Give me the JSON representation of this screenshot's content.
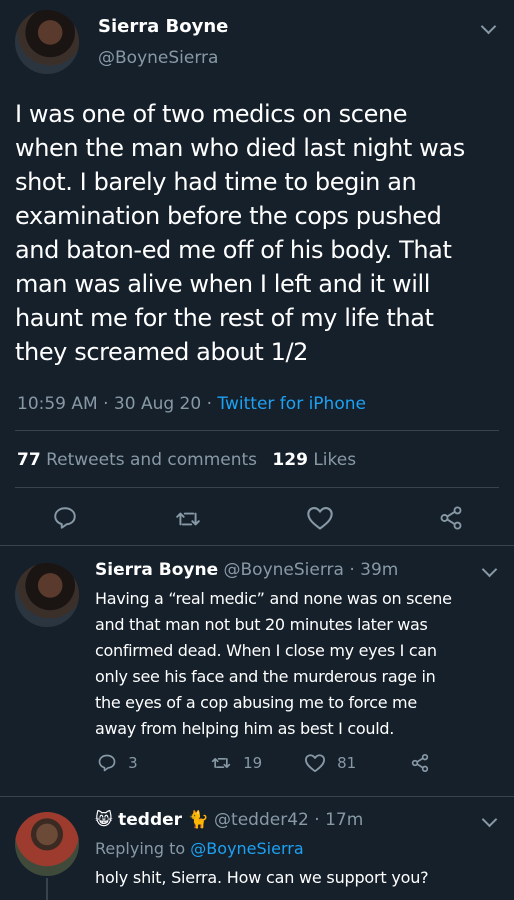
{
  "main_tweet": {
    "name": "Sierra Boyne",
    "handle": "@BoyneSierra",
    "lines": [
      "I was one of two medics on scene",
      "when the man who died last night was",
      "shot. I barely had time to begin an",
      "examination before the cops pushed",
      "and baton-ed me off of his body. That",
      "man was alive when I left and it will",
      "haunt me for the rest of my life that",
      "they screamed about 1/2"
    ],
    "time": "10:59 AM",
    "date": "30 Aug 20",
    "separator": "·",
    "source": "Twitter for iPhone",
    "retweet_count": "77",
    "retweet_label": "Retweets and comments",
    "like_count": "129",
    "like_label": "Likes"
  },
  "reply_1": {
    "name": "Sierra Boyne",
    "handle": "@BoyneSierra",
    "separator": "·",
    "age": "39m",
    "lines": [
      "Having a “real medic” and none was on scene",
      "and that man not but 20 minutes later was",
      "confirmed dead. When I close my eyes I can",
      "only see his face and the murderous rage in",
      "the eyes of a cop abusing me to force me",
      "away from helping him as best I could."
    ],
    "reply_count": "3",
    "retweet_count": "19",
    "like_count": "81"
  },
  "reply_2": {
    "emoji_left": "😸",
    "name": "tedder",
    "emoji_right": "🐈",
    "handle": "@tedder42",
    "separator": "·",
    "age": "17m",
    "replying_prefix": "Replying to",
    "replying_to": "@BoyneSierra",
    "text": "holy shit, Sierra. How can we support you?"
  },
  "colors": {
    "background": "#15202b",
    "text": "#ffffff",
    "secondary": "#8899a6",
    "accent": "#1da1f2",
    "divider": "#38444d"
  },
  "icons": [
    "chevron-down-icon",
    "reply-icon",
    "retweet-icon",
    "like-icon",
    "share-icon"
  ]
}
